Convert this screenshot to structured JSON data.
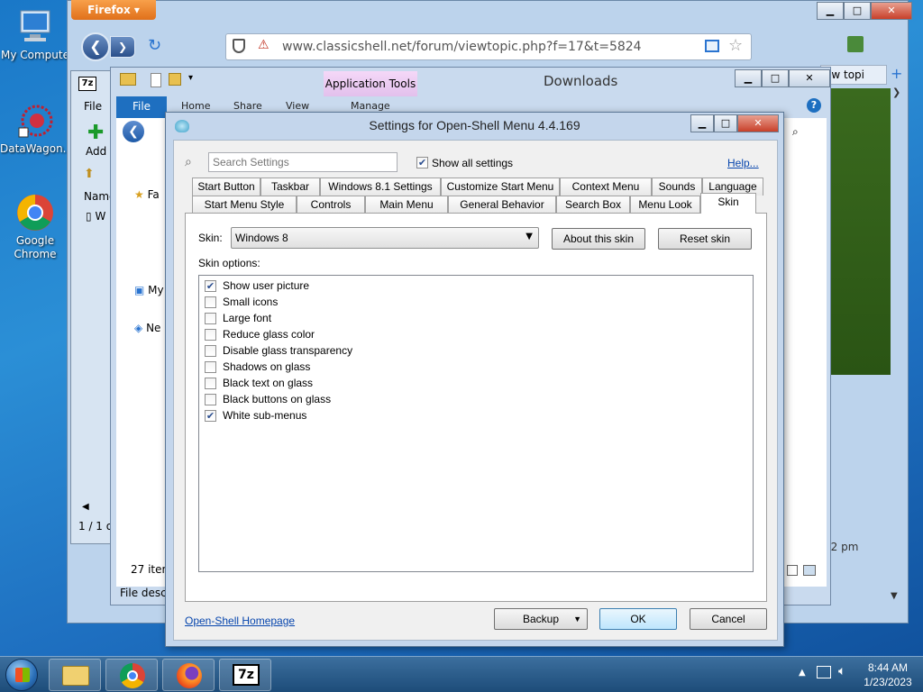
{
  "desktop": {
    "icons": [
      {
        "label": "My Compute"
      },
      {
        "label": "DataWagon..."
      },
      {
        "label": "Google Chrome"
      }
    ]
  },
  "firefox": {
    "menu_label": "Firefox",
    "url": "www.classicshell.net/forum/viewtopic.php?f=17&t=5824",
    "tab_label": "ew topi",
    "caption": {
      "min": "▁",
      "max": "□",
      "close": "✕"
    }
  },
  "explorer": {
    "title": "Downloads",
    "app_tools": "Application Tools",
    "tabs": [
      "File",
      "Home",
      "Share",
      "View"
    ],
    "manage": "Manage",
    "sidebar": [
      "Fa",
      "My",
      "Ne"
    ],
    "column_name": "Name",
    "file_row": "W",
    "items_count": "27 item",
    "file_desc": "File descri",
    "status_7z": "1 / 1 o"
  },
  "sevenzip": {
    "menu_file": "File",
    "add_label": "Add"
  },
  "dialog": {
    "title": "Settings for Open-Shell Menu 4.4.169",
    "search_placeholder": "Search Settings",
    "show_all_label": "Show all settings",
    "show_all_checked": true,
    "help_link": "Help...",
    "tabs_row1": [
      "Start Button",
      "Taskbar",
      "Windows 8.1 Settings",
      "Customize Start Menu",
      "Context Menu",
      "Sounds",
      "Language"
    ],
    "tabs_row2": [
      "Start Menu Style",
      "Controls",
      "Main Menu",
      "General Behavior",
      "Search Box",
      "Menu Look",
      "Skin"
    ],
    "active_tab": "Skin",
    "skin_label": "Skin:",
    "skin_value": "Windows 8",
    "about_button": "About this skin",
    "reset_button": "Reset skin",
    "options_label": "Skin options:",
    "options": [
      {
        "label": "Show user picture",
        "checked": true
      },
      {
        "label": "Small icons",
        "checked": false
      },
      {
        "label": "Large font",
        "checked": false
      },
      {
        "label": "Reduce glass color",
        "checked": false
      },
      {
        "label": "Disable glass transparency",
        "checked": false
      },
      {
        "label": "Shadows on glass",
        "checked": false
      },
      {
        "label": "Black text on glass",
        "checked": false
      },
      {
        "label": "Black buttons on glass",
        "checked": false
      },
      {
        "label": "White sub-menus",
        "checked": true
      }
    ],
    "homepage_link": "Open-Shell Homepage",
    "backup_button": "Backup",
    "ok_button": "OK",
    "cancel_button": "Cancel",
    "caption": {
      "min": "▁",
      "max": "□",
      "close": "✕"
    }
  },
  "taskbar": {
    "time": "8:44 AM",
    "date": "1/23/2023",
    "apps": [
      "Windows Explorer",
      "Google Chrome",
      "Firefox",
      "7-Zip"
    ],
    "seven_zip_label": "7z"
  },
  "colors": {
    "accent_blue": "#1e74c6",
    "firefox_orange": "#e8781f",
    "app_tools_pink": "#e8c8f0",
    "green_panel": "#33621a"
  }
}
